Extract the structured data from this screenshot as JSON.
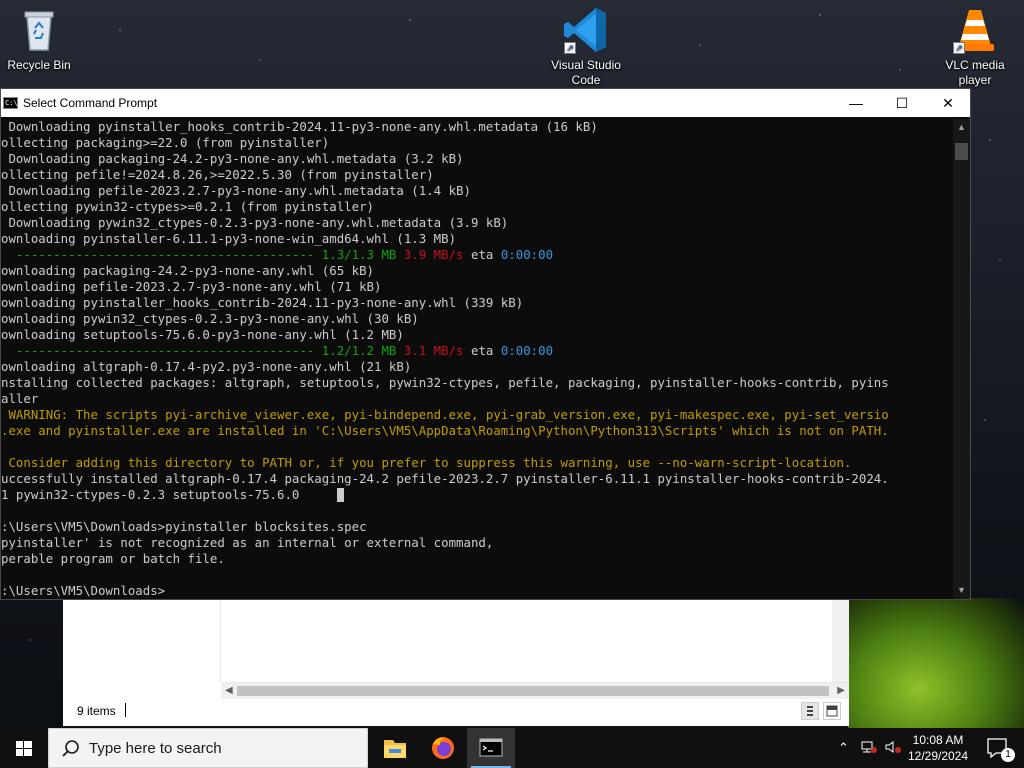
{
  "desktop": {
    "icons": [
      {
        "label": "Recycle Bin",
        "icon": "recycle-bin-icon"
      },
      {
        "label": "Visual Studio Code",
        "icon": "vscode-icon"
      },
      {
        "label": "VLC media player",
        "icon": "vlc-icon"
      }
    ]
  },
  "cmd_window": {
    "title": "Select Command Prompt",
    "controls": {
      "minimize": "—",
      "maximize": "☐",
      "close": "✕"
    },
    "lines": [
      {
        "segments": [
          {
            "text": " Downloading pyinstaller_hooks_contrib-2024.11-py3-none-any.whl.metadata (16 kB)",
            "color": "default"
          }
        ]
      },
      {
        "segments": [
          {
            "text": "ollecting packaging>=22.0 (from pyinstaller)",
            "color": "default"
          }
        ]
      },
      {
        "segments": [
          {
            "text": " Downloading packaging-24.2-py3-none-any.whl.metadata (3.2 kB)",
            "color": "default"
          }
        ]
      },
      {
        "segments": [
          {
            "text": "ollecting pefile!=2024.8.26,>=2022.5.30 (from pyinstaller)",
            "color": "default"
          }
        ]
      },
      {
        "segments": [
          {
            "text": " Downloading pefile-2023.2.7-py3-none-any.whl.metadata (1.4 kB)",
            "color": "default"
          }
        ]
      },
      {
        "segments": [
          {
            "text": "ollecting pywin32-ctypes>=0.2.1 (from pyinstaller)",
            "color": "default"
          }
        ]
      },
      {
        "segments": [
          {
            "text": " Downloading pywin32_ctypes-0.2.3-py3-none-any.whl.metadata (3.9 kB)",
            "color": "default"
          }
        ]
      },
      {
        "segments": [
          {
            "text": "ownloading pyinstaller-6.11.1-py3-none-win_amd64.whl (1.3 MB)",
            "color": "default"
          }
        ]
      },
      {
        "segments": [
          {
            "text": "  ---------------------------------------- ",
            "color": "green"
          },
          {
            "text": "1.3/1.3 MB ",
            "color": "green"
          },
          {
            "text": "3.9 MB/s",
            "color": "red"
          },
          {
            "text": " eta ",
            "color": "default"
          },
          {
            "text": "0:00:00",
            "color": "cyan"
          }
        ]
      },
      {
        "segments": [
          {
            "text": "ownloading packaging-24.2-py3-none-any.whl (65 kB)",
            "color": "default"
          }
        ]
      },
      {
        "segments": [
          {
            "text": "ownloading pefile-2023.2.7-py3-none-any.whl (71 kB)",
            "color": "default"
          }
        ]
      },
      {
        "segments": [
          {
            "text": "ownloading pyinstaller_hooks_contrib-2024.11-py3-none-any.whl (339 kB)",
            "color": "default"
          }
        ]
      },
      {
        "segments": [
          {
            "text": "ownloading pywin32_ctypes-0.2.3-py3-none-any.whl (30 kB)",
            "color": "default"
          }
        ]
      },
      {
        "segments": [
          {
            "text": "ownloading setuptools-75.6.0-py3-none-any.whl (1.2 MB)",
            "color": "default"
          }
        ]
      },
      {
        "segments": [
          {
            "text": "  ---------------------------------------- ",
            "color": "green"
          },
          {
            "text": "1.2/1.2 MB ",
            "color": "green"
          },
          {
            "text": "3.1 MB/s",
            "color": "red"
          },
          {
            "text": " eta ",
            "color": "default"
          },
          {
            "text": "0:00:00",
            "color": "cyan"
          }
        ]
      },
      {
        "segments": [
          {
            "text": "ownloading altgraph-0.17.4-py2.py3-none-any.whl (21 kB)",
            "color": "default"
          }
        ]
      },
      {
        "segments": [
          {
            "text": "nstalling collected packages: altgraph, setuptools, pywin32-ctypes, pefile, packaging, pyinstaller-hooks-contrib, pyins",
            "color": "default"
          }
        ]
      },
      {
        "segments": [
          {
            "text": "aller",
            "color": "default"
          }
        ]
      },
      {
        "segments": [
          {
            "text": " WARNING: The scripts pyi-archive_viewer.exe, pyi-bindepend.exe, pyi-grab_version.exe, pyi-makespec.exe, pyi-set_versio",
            "color": "yellow"
          }
        ]
      },
      {
        "segments": [
          {
            "text": ".exe and pyinstaller.exe are installed in 'C:\\Users\\VM5\\AppData\\Roaming\\Python\\Python313\\Scripts' which is not on PATH.",
            "color": "yellow"
          }
        ]
      },
      {
        "segments": [
          {
            "text": "",
            "color": "default"
          }
        ]
      },
      {
        "segments": [
          {
            "text": " Consider adding this directory to PATH or, if you prefer to suppress this warning, use --no-warn-script-location.",
            "color": "yellow"
          }
        ]
      },
      {
        "segments": [
          {
            "text": "uccessfully installed altgraph-0.17.4 packaging-24.2 pefile-2023.2.7 pyinstaller-6.11.1 pyinstaller-hooks-contrib-2024.",
            "color": "default"
          }
        ]
      },
      {
        "segments": [
          {
            "text": "1 pywin32-ctypes-0.2.3 setuptools-75.6.0",
            "color": "default"
          }
        ],
        "cursor": true
      },
      {
        "segments": [
          {
            "text": "",
            "color": "default"
          }
        ]
      },
      {
        "segments": [
          {
            "text": ":\\Users\\VM5\\Downloads>pyinstaller blocksites.spec",
            "color": "default"
          }
        ]
      },
      {
        "segments": [
          {
            "text": "pyinstaller' is not recognized as an internal or external command,",
            "color": "default"
          }
        ]
      },
      {
        "segments": [
          {
            "text": "perable program or batch file.",
            "color": "default"
          }
        ]
      },
      {
        "segments": [
          {
            "text": "",
            "color": "default"
          }
        ]
      },
      {
        "segments": [
          {
            "text": ":\\Users\\VM5\\Downloads>",
            "color": "default"
          }
        ]
      }
    ]
  },
  "explorer": {
    "status_count": "9 items"
  },
  "taskbar": {
    "search_placeholder": "Type here to search",
    "pinned": [
      {
        "name": "file-explorer-icon",
        "active": false
      },
      {
        "name": "firefox-icon",
        "active": false
      },
      {
        "name": "command-prompt-icon",
        "active": true
      }
    ],
    "time": "10:08 AM",
    "date": "12/29/2024",
    "notification_count": "1"
  },
  "colors": {
    "console_bg": "#0c0c0c",
    "console_fg": "#cccccc",
    "green": "#13a10e",
    "red": "#c50f1f",
    "cyan": "#3a96dd",
    "yellow": "#c19c00",
    "taskbar_bg": "#101010"
  }
}
